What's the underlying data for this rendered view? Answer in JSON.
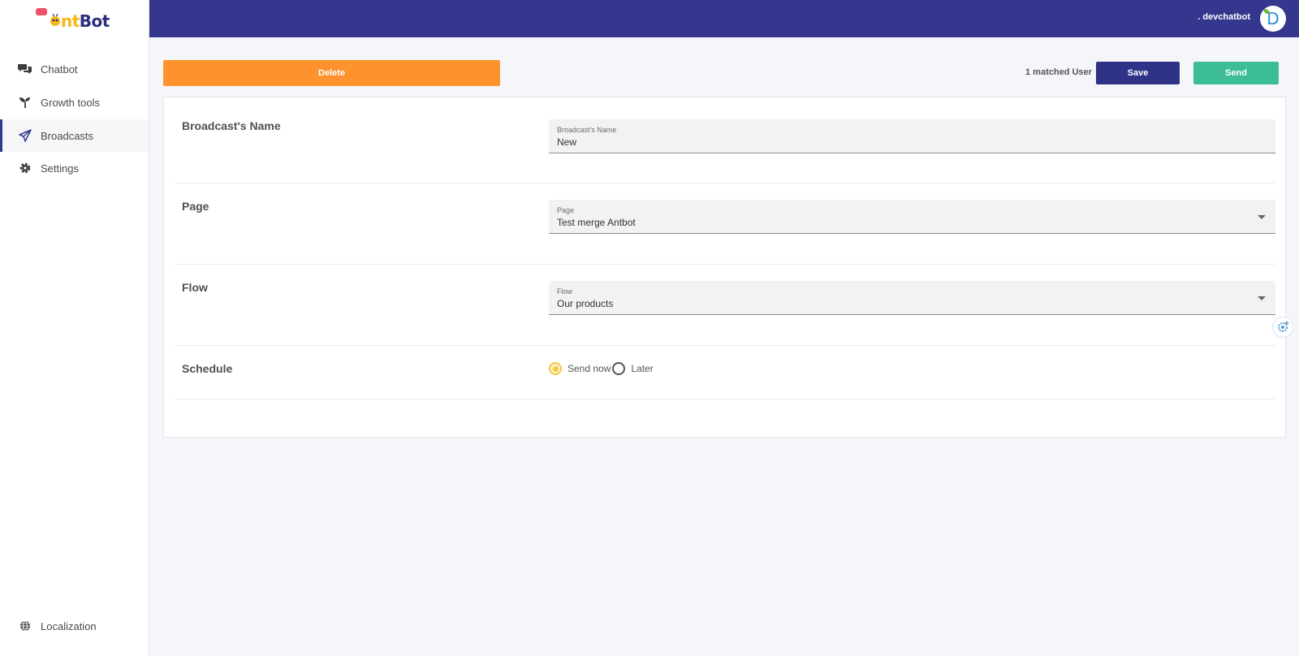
{
  "brand": {
    "name_part1": "Ant",
    "name_part2": "Bot"
  },
  "sidebar": {
    "items": [
      {
        "label": "Chatbot",
        "icon": "chat-bubbles-icon",
        "active": false
      },
      {
        "label": "Growth tools",
        "icon": "sprout-icon",
        "active": false
      },
      {
        "label": "Broadcasts",
        "icon": "paper-plane-icon",
        "active": true
      },
      {
        "label": "Settings",
        "icon": "gear-icon",
        "active": false
      }
    ],
    "footer": {
      "label": "Localization",
      "icon": "globe-icon"
    }
  },
  "header": {
    "username": ". devchatbot",
    "avatar_letter": "D"
  },
  "toolbar": {
    "delete_label": "Delete",
    "matched_text": "1 matched User",
    "save_label": "Save",
    "send_label": "Send"
  },
  "form": {
    "name": {
      "label": "Broadcast's Name",
      "field_label": "Broadcast's Name",
      "value": "New"
    },
    "page": {
      "label": "Page",
      "field_label": "Page",
      "value": "Test merge Antbot"
    },
    "flow": {
      "label": "Flow",
      "field_label": "Flow",
      "value": "Our products"
    },
    "schedule": {
      "label": "Schedule",
      "options": [
        {
          "label": "Send now",
          "checked": true
        },
        {
          "label": "Later",
          "checked": false
        }
      ]
    }
  },
  "colors": {
    "header": "#34378d",
    "delete": "#fd922e",
    "save": "#2f3387",
    "send": "#3dbd95",
    "radio_selected": "#f5c842"
  }
}
